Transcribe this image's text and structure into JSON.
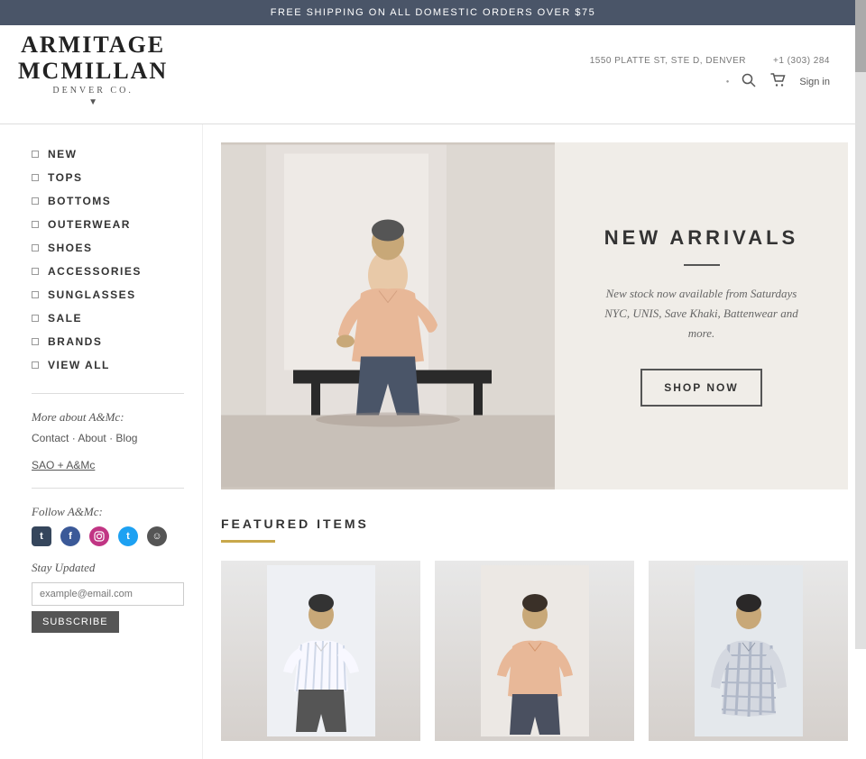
{
  "banner": {
    "text": "FREE SHIPPING ON ALL DOMESTIC ORDERS OVER $75"
  },
  "header": {
    "address": "1550 PLATTE ST, STE D, DENVER",
    "phone": "+1 (303) 284",
    "sign_in": "Sign in",
    "logo_line1": "ARMITAGE",
    "logo_line2": "McMILLAN",
    "logo_sub": "DENVER CO.",
    "logo_arrow": "▼"
  },
  "nav": {
    "items": [
      {
        "label": "NEW",
        "id": "new"
      },
      {
        "label": "TOPS",
        "id": "tops"
      },
      {
        "label": "BOTTOMS",
        "id": "bottoms"
      },
      {
        "label": "OUTERWEAR",
        "id": "outerwear"
      },
      {
        "label": "SHOES",
        "id": "shoes"
      },
      {
        "label": "ACCESSORIES",
        "id": "accessories"
      },
      {
        "label": "SUNGLASSES",
        "id": "sunglasses"
      },
      {
        "label": "SALE",
        "id": "sale"
      },
      {
        "label": "BRANDS",
        "id": "brands"
      },
      {
        "label": "VIEW ALL",
        "id": "view-all"
      }
    ]
  },
  "sidebar": {
    "more_about": "More about A&Mc:",
    "contact": "Contact",
    "about": "About",
    "blog": "Blog",
    "sao_link": "SAO + A&Mc",
    "follow": "Follow A&Mc:",
    "stay_updated": "Stay Updated",
    "email_placeholder": "example@email.com",
    "subscribe_label": "SUBSCRIBE"
  },
  "hero": {
    "title": "NEW ARRIVALS",
    "description": "New stock now available from Saturdays NYC, UNIS, Save Khaki, Battenwear and more.",
    "shop_now": "SHOP NOW"
  },
  "featured": {
    "title": "FEATURED ITEMS"
  }
}
